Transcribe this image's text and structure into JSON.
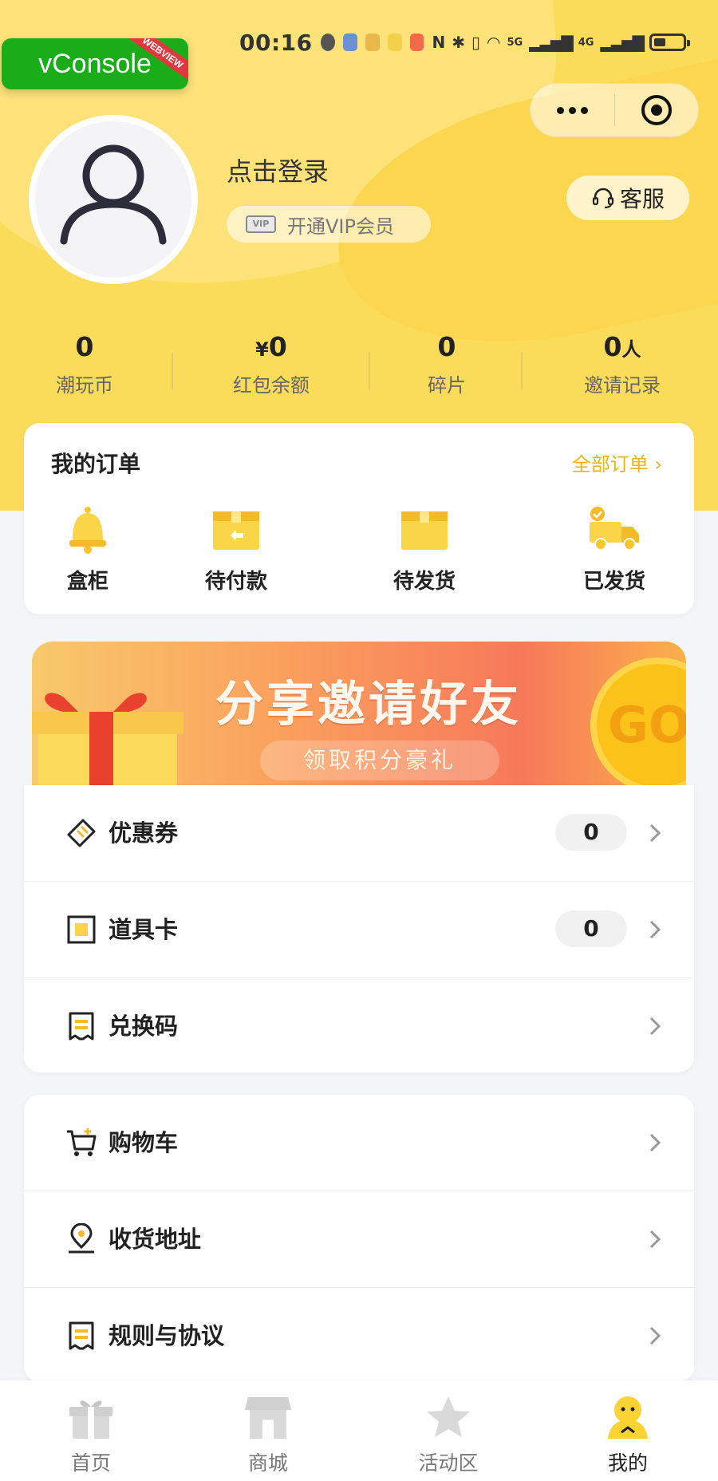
{
  "status_bar": {
    "time": "00:16",
    "network_labels": [
      "5G",
      "4G"
    ]
  },
  "vconsole": {
    "label": "vConsole",
    "ribbon": "WEBVIEW"
  },
  "profile": {
    "login_text": "点击登录",
    "vip_badge": "VIP",
    "vip_text": "开通VIP会员",
    "service_label": "客服"
  },
  "stats": [
    {
      "value": "0",
      "prefix": "",
      "suffix": "",
      "label": "潮玩币"
    },
    {
      "value": "0",
      "prefix": "¥",
      "suffix": "",
      "label": "红包余额"
    },
    {
      "value": "0",
      "prefix": "",
      "suffix": "",
      "label": "碎片"
    },
    {
      "value": "0",
      "prefix": "",
      "suffix": "人",
      "label": "邀请记录"
    }
  ],
  "orders": {
    "title": "我的订单",
    "all_label": "全部订单 ›",
    "items": [
      {
        "label": "盒柜",
        "icon": "bell-icon"
      },
      {
        "label": "待付款",
        "icon": "box-return-icon"
      },
      {
        "label": "待发货",
        "icon": "box-icon"
      },
      {
        "label": "已发货",
        "icon": "truck-icon"
      }
    ]
  },
  "banner": {
    "headline": "分享邀请好友",
    "subtitle": "领取积分豪礼",
    "go_text": "GO"
  },
  "menu_group1": [
    {
      "label": "优惠券",
      "count": "0",
      "icon": "coupon-icon"
    },
    {
      "label": "道具卡",
      "count": "0",
      "icon": "card-icon"
    },
    {
      "label": "兑换码",
      "count": null,
      "icon": "receipt-icon"
    }
  ],
  "menu_group2": [
    {
      "label": "购物车",
      "icon": "cart-icon"
    },
    {
      "label": "收货地址",
      "icon": "location-icon"
    },
    {
      "label": "规则与协议",
      "icon": "document-icon"
    }
  ],
  "tabbar": [
    {
      "label": "首页",
      "icon": "gift-icon",
      "active": false
    },
    {
      "label": "商城",
      "icon": "shop-icon",
      "active": false
    },
    {
      "label": "活动区",
      "icon": "star-icon",
      "active": false
    },
    {
      "label": "我的",
      "icon": "user-icon",
      "active": true
    }
  ],
  "colors": {
    "accent": "#fbdc5a",
    "link": "#e8b520",
    "active_tab": "#fbd433"
  }
}
